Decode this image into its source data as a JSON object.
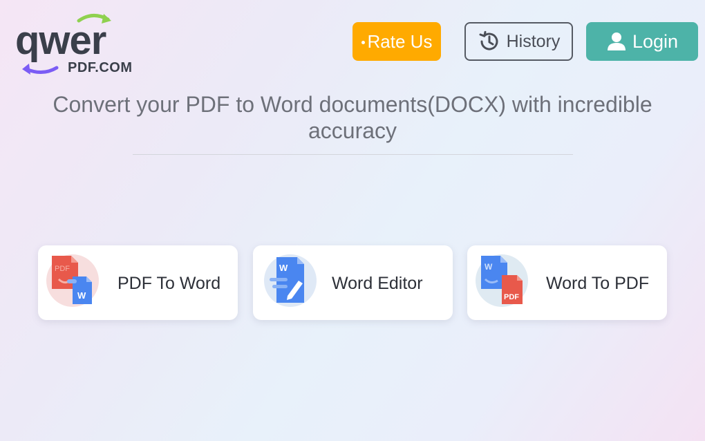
{
  "logo": {
    "wordmark": "qwer",
    "domain": "PDF.COM"
  },
  "header": {
    "rate_label": "Rate Us",
    "history_label": "History",
    "login_label": "Login"
  },
  "headline": "Convert your PDF to Word documents(DOCX) with incredible accuracy",
  "tools": [
    {
      "label": "PDF To Word",
      "icon": "pdf-to-word-icon"
    },
    {
      "label": "Word Editor",
      "icon": "word-editor-icon"
    },
    {
      "label": "Word To PDF",
      "icon": "word-to-pdf-icon"
    }
  ],
  "icon_badges": {
    "pdf": "PDF",
    "word": "W"
  },
  "colors": {
    "rate_button": "#ffaa00",
    "login_button": "#4db3a8",
    "logo_arrow_green": "#8fd14f",
    "logo_arrow_purple": "#7b5cf5",
    "pdf_red": "#e8594b",
    "word_blue": "#4a86f0"
  }
}
